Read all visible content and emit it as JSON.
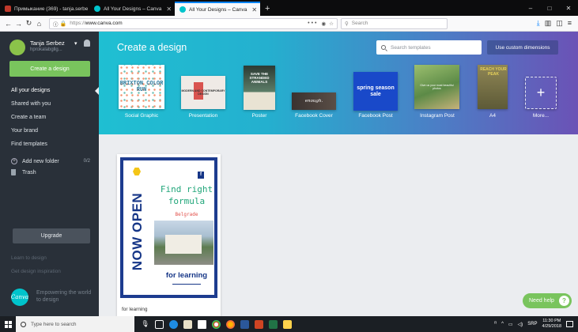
{
  "browser": {
    "tabs": [
      {
        "title": "Примыкание (369) - tanja.serbe",
        "close": "✕",
        "favicon_color": "#c0392b"
      },
      {
        "title": "All Your Designs – Canva",
        "close": "✕",
        "favicon_color": "#00c4cc"
      },
      {
        "title": "All Your Designs – Canva",
        "close": "✕",
        "favicon_color": "#00c4cc"
      }
    ],
    "new_tab": "+",
    "url_protocol": "https://",
    "url_host": "www.canva.com",
    "url_actions": "•••",
    "search_placeholder": "Search",
    "window_controls": {
      "min": "–",
      "max": "□",
      "close": "✕"
    }
  },
  "sidebar": {
    "user_name": "Tanja Serbez",
    "user_handle": "hprokalabgllg...",
    "create_button": "Create a design",
    "nav": [
      {
        "label": "All your designs",
        "active": true
      },
      {
        "label": "Shared with you",
        "active": false
      },
      {
        "label": "Create a team",
        "active": false
      },
      {
        "label": "Your brand",
        "active": false
      },
      {
        "label": "Find templates",
        "active": false
      }
    ],
    "add_folder": "Add new folder",
    "add_folder_count": "0/2",
    "trash": "Trash",
    "upgrade": "Upgrade",
    "learn_link": "Learn to design",
    "inspiration_link": "Get design inspiration",
    "brand_logo": "Canva",
    "brand_tagline": "Empowering the world to design"
  },
  "hero": {
    "title": "Create a design",
    "search_placeholder": "Search templates",
    "custom_dimensions": "Use custom dimensions",
    "templates": [
      {
        "label": "Social Graphic",
        "thumb_text": "BRIXTON COLOR RUN"
      },
      {
        "label": "Presentation",
        "thumb_text": "MODERN AND CONTEMPORARY DESIGN"
      },
      {
        "label": "Poster",
        "thumb_text": "SAVE THE STRANDED ANIMALS"
      },
      {
        "label": "Facebook Cover",
        "thumb_text": "enough."
      },
      {
        "label": "Facebook Post",
        "thumb_text": "spring season sale"
      },
      {
        "label": "Instagram Post",
        "thumb_text": "Give us your most beautiful photos"
      },
      {
        "label": "A4",
        "thumb_text": "REACH YOUR PEAK"
      },
      {
        "label": "More...",
        "thumb_text": "+"
      }
    ]
  },
  "designs": [
    {
      "title": "for learning",
      "poster": {
        "headline": "NOW OPEN",
        "line1": "Find right",
        "line2": "formula",
        "city": "Belgrade",
        "footer": "for learning",
        "fb": "f"
      }
    }
  ],
  "help_button": "Need help",
  "taskbar": {
    "search_placeholder": "Type here to search",
    "lang": "SRP",
    "time": "11:30 PM",
    "date": "4/29/2018"
  },
  "colors": {
    "canva_green": "#79c45d",
    "sidebar_bg": "#293039",
    "poster_blue": "#163687"
  }
}
